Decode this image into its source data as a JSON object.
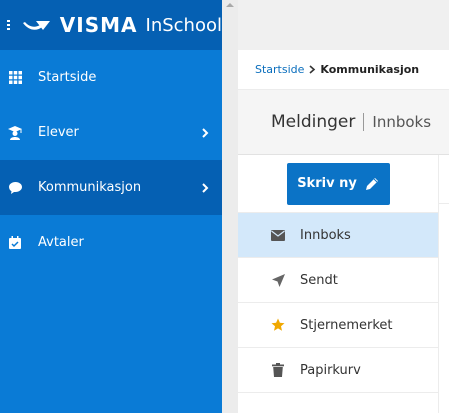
{
  "brand": {
    "name": "VISMA",
    "product": "InSchool"
  },
  "nav": [
    {
      "label": "Startside",
      "icon": "grid-icon"
    },
    {
      "label": "Elever",
      "icon": "student-icon",
      "has_submenu": true
    },
    {
      "label": "Kommunikasjon",
      "icon": "chat-icon",
      "has_submenu": true,
      "active": true
    },
    {
      "label": "Avtaler",
      "icon": "calendar-icon"
    }
  ],
  "breadcrumb": {
    "home": "Startside",
    "current": "Kommunikasjon"
  },
  "header": {
    "title": "Meldinger",
    "subtitle": "Innboks"
  },
  "compose": {
    "label": "Skriv ny",
    "icon": "pencil-icon"
  },
  "folders": [
    {
      "label": "Innboks",
      "icon": "envelope-icon",
      "active": true
    },
    {
      "label": "Sendt",
      "icon": "send-icon"
    },
    {
      "label": "Stjernemerket",
      "icon": "star-icon"
    },
    {
      "label": "Papirkurv",
      "icon": "trash-icon"
    }
  ],
  "colors": {
    "sidebar": "#0a7bd6",
    "sidebar_active": "#0560b3",
    "button": "#0b73c6",
    "folder_active": "#d3e8fa",
    "star": "#f0a800"
  }
}
